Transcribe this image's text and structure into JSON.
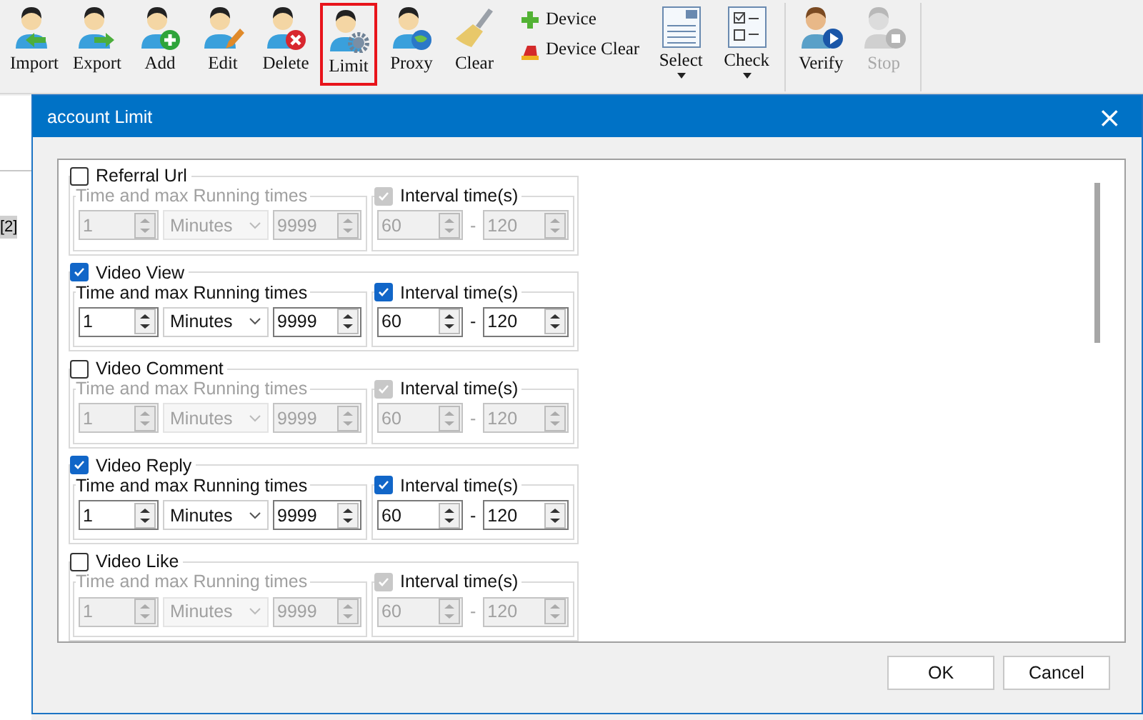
{
  "toolbar": {
    "main": [
      {
        "label": "Import",
        "selected": false
      },
      {
        "label": "Export",
        "selected": false
      },
      {
        "label": "Add",
        "selected": false
      },
      {
        "label": "Edit",
        "selected": false
      },
      {
        "label": "Delete",
        "selected": false
      },
      {
        "label": "Limit",
        "selected": true
      },
      {
        "label": "Proxy",
        "selected": false
      },
      {
        "label": "Clear",
        "selected": false
      }
    ],
    "small": [
      {
        "label": "Device"
      },
      {
        "label": "Device Clear"
      }
    ],
    "menus": [
      {
        "label": "Select"
      },
      {
        "label": "Check"
      }
    ],
    "actions": [
      {
        "label": "Verify",
        "disabled": false
      },
      {
        "label": "Stop",
        "disabled": true
      }
    ]
  },
  "background": {
    "cell": "[2]"
  },
  "dialog": {
    "title": "account Limit",
    "close": "×",
    "sections": [
      {
        "label": "Referral Url",
        "enabled": false,
        "times_label": "Time and max Running times",
        "count": "1",
        "unit": "Minutes",
        "max": "9999",
        "interval_label": "Interval time(s)",
        "interval_checked": true,
        "from": "60",
        "dash": "-",
        "to": "120"
      },
      {
        "label": "Video View",
        "enabled": true,
        "times_label": "Time and max Running times",
        "count": "1",
        "unit": "Minutes",
        "max": "9999",
        "interval_label": "Interval time(s)",
        "interval_checked": true,
        "from": "60",
        "dash": "-",
        "to": "120"
      },
      {
        "label": "Video Comment",
        "enabled": false,
        "times_label": "Time and max Running times",
        "count": "1",
        "unit": "Minutes",
        "max": "9999",
        "interval_label": "Interval time(s)",
        "interval_checked": true,
        "from": "60",
        "dash": "-",
        "to": "120"
      },
      {
        "label": "Video Reply",
        "enabled": true,
        "times_label": "Time and max Running times",
        "count": "1",
        "unit": "Minutes",
        "max": "9999",
        "interval_label": "Interval time(s)",
        "interval_checked": true,
        "from": "60",
        "dash": "-",
        "to": "120"
      },
      {
        "label": "Video Like",
        "enabled": false,
        "times_label": "Time and max Running times",
        "count": "1",
        "unit": "Minutes",
        "max": "9999",
        "interval_label": "Interval time(s)",
        "interval_checked": true,
        "from": "60",
        "dash": "-",
        "to": "120"
      }
    ],
    "buttons": [
      "OK",
      "Cancel"
    ]
  }
}
